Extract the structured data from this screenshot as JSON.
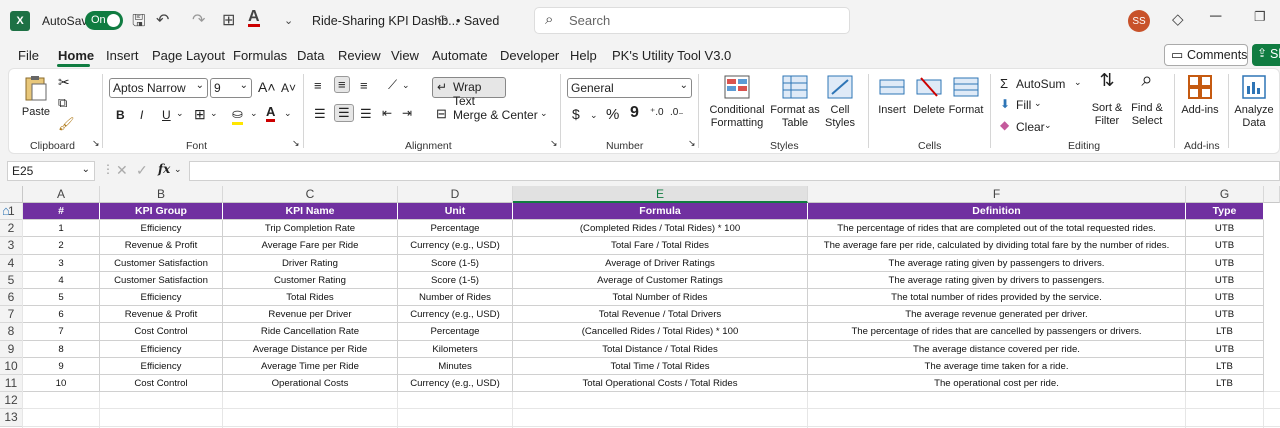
{
  "titlebar": {
    "logo": "X",
    "autosave_label": "AutoSave",
    "autosave_state": "On",
    "doc_title": "Ride-Sharing KPI Dashb...",
    "saved_label": "• Saved",
    "search_placeholder": "Search",
    "avatar_initials": "SS"
  },
  "tabs": [
    "File",
    "Home",
    "Insert",
    "Page Layout",
    "Formulas",
    "Data",
    "Review",
    "View",
    "Automate",
    "Developer",
    "Help",
    "PK's Utility Tool V3.0"
  ],
  "active_tab": "Home",
  "comments_label": "Comments",
  "share_label": "Sh",
  "ribbon": {
    "clipboard": {
      "paste": "Paste",
      "group": "Clipboard"
    },
    "font": {
      "name": "Aptos Narrow",
      "size": "9",
      "bold": "B",
      "italic": "I",
      "underline": "U",
      "group": "Font"
    },
    "alignment": {
      "wrap": "Wrap Text",
      "merge": "Merge & Center",
      "group": "Alignment"
    },
    "number": {
      "format": "General",
      "currency": "$",
      "percent": "%",
      "comma": "9",
      "group": "Number"
    },
    "styles": {
      "conditional1": "Conditional",
      "conditional2": "Formatting",
      "format_table1": "Format as",
      "format_table2": "Table",
      "cell_styles1": "Cell",
      "cell_styles2": "Styles",
      "group": "Styles"
    },
    "cells": {
      "insert": "Insert",
      "delete": "Delete",
      "format": "Format",
      "group": "Cells"
    },
    "editing": {
      "autosum": "AutoSum",
      "fill": "Fill",
      "clear": "Clear",
      "sort1": "Sort &",
      "sort2": "Filter",
      "find1": "Find &",
      "find2": "Select",
      "group": "Editing"
    },
    "addins": {
      "label": "Add-ins",
      "group": "Add-ins"
    },
    "analyze": {
      "label1": "Analyze",
      "label2": "Data"
    }
  },
  "formula_bar": {
    "name_box": "E25",
    "fx": "fx",
    "value": ""
  },
  "columns": [
    "A",
    "B",
    "C",
    "D",
    "E",
    "F",
    "G"
  ],
  "selected_column": "E",
  "rows": [
    "1",
    "2",
    "3",
    "4",
    "5",
    "6",
    "7",
    "8",
    "9",
    "10",
    "11",
    "12",
    "13"
  ],
  "table": {
    "headers": [
      "#",
      "KPI Group",
      "KPI Name",
      "Unit",
      "Formula",
      "Definition",
      "Type"
    ],
    "rows": [
      [
        "1",
        "Efficiency",
        "Trip Completion Rate",
        "Percentage",
        "(Completed Rides / Total Rides) * 100",
        "The percentage of rides that are completed out of the total requested rides.",
        "UTB"
      ],
      [
        "2",
        "Revenue & Profit",
        "Average Fare per Ride",
        "Currency (e.g., USD)",
        "Total Fare / Total Rides",
        "The average fare per ride, calculated by dividing total fare by the number of rides.",
        "UTB"
      ],
      [
        "3",
        "Customer Satisfaction",
        "Driver Rating",
        "Score (1-5)",
        "Average of Driver Ratings",
        "The average rating given by passengers to drivers.",
        "UTB"
      ],
      [
        "4",
        "Customer Satisfaction",
        "Customer Rating",
        "Score (1-5)",
        "Average of Customer Ratings",
        "The average rating given by drivers to passengers.",
        "UTB"
      ],
      [
        "5",
        "Efficiency",
        "Total Rides",
        "Number of Rides",
        "Total Number of Rides",
        "The total number of rides provided by the service.",
        "UTB"
      ],
      [
        "6",
        "Revenue & Profit",
        "Revenue per Driver",
        "Currency (e.g., USD)",
        "Total Revenue / Total Drivers",
        "The average revenue generated per driver.",
        "UTB"
      ],
      [
        "7",
        "Cost Control",
        "Ride Cancellation Rate",
        "Percentage",
        "(Cancelled Rides / Total Rides) * 100",
        "The percentage of rides that are cancelled by passengers or drivers.",
        "LTB"
      ],
      [
        "8",
        "Efficiency",
        "Average Distance per Ride",
        "Kilometers",
        "Total Distance / Total Rides",
        "The average distance covered per ride.",
        "UTB"
      ],
      [
        "9",
        "Efficiency",
        "Average Time per Ride",
        "Minutes",
        "Total Time / Total Rides",
        "The average time taken for a ride.",
        "LTB"
      ],
      [
        "10",
        "Cost Control",
        "Operational Costs",
        "Currency (e.g., USD)",
        "Total Operational Costs / Total Rides",
        "The operational cost per ride.",
        "LTB"
      ]
    ]
  },
  "colors": {
    "header_fill": "#7030a0",
    "accent": "#107c41"
  }
}
